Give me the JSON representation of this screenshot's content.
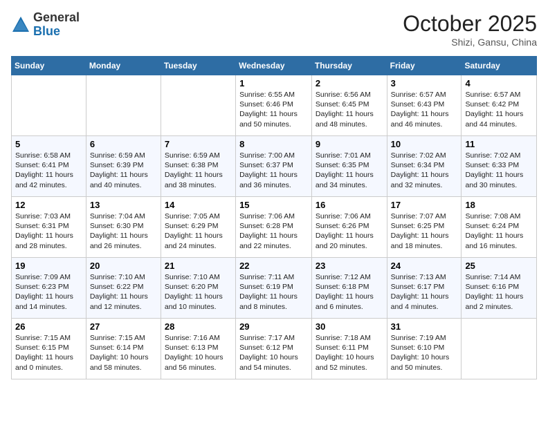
{
  "header": {
    "logo_general": "General",
    "logo_blue": "Blue",
    "month": "October 2025",
    "location": "Shizi, Gansu, China"
  },
  "days_of_week": [
    "Sunday",
    "Monday",
    "Tuesday",
    "Wednesday",
    "Thursday",
    "Friday",
    "Saturday"
  ],
  "weeks": [
    [
      {
        "day": "",
        "content": ""
      },
      {
        "day": "",
        "content": ""
      },
      {
        "day": "",
        "content": ""
      },
      {
        "day": "1",
        "content": "Sunrise: 6:55 AM\nSunset: 6:46 PM\nDaylight: 11 hours and 50 minutes."
      },
      {
        "day": "2",
        "content": "Sunrise: 6:56 AM\nSunset: 6:45 PM\nDaylight: 11 hours and 48 minutes."
      },
      {
        "day": "3",
        "content": "Sunrise: 6:57 AM\nSunset: 6:43 PM\nDaylight: 11 hours and 46 minutes."
      },
      {
        "day": "4",
        "content": "Sunrise: 6:57 AM\nSunset: 6:42 PM\nDaylight: 11 hours and 44 minutes."
      }
    ],
    [
      {
        "day": "5",
        "content": "Sunrise: 6:58 AM\nSunset: 6:41 PM\nDaylight: 11 hours and 42 minutes."
      },
      {
        "day": "6",
        "content": "Sunrise: 6:59 AM\nSunset: 6:39 PM\nDaylight: 11 hours and 40 minutes."
      },
      {
        "day": "7",
        "content": "Sunrise: 6:59 AM\nSunset: 6:38 PM\nDaylight: 11 hours and 38 minutes."
      },
      {
        "day": "8",
        "content": "Sunrise: 7:00 AM\nSunset: 6:37 PM\nDaylight: 11 hours and 36 minutes."
      },
      {
        "day": "9",
        "content": "Sunrise: 7:01 AM\nSunset: 6:35 PM\nDaylight: 11 hours and 34 minutes."
      },
      {
        "day": "10",
        "content": "Sunrise: 7:02 AM\nSunset: 6:34 PM\nDaylight: 11 hours and 32 minutes."
      },
      {
        "day": "11",
        "content": "Sunrise: 7:02 AM\nSunset: 6:33 PM\nDaylight: 11 hours and 30 minutes."
      }
    ],
    [
      {
        "day": "12",
        "content": "Sunrise: 7:03 AM\nSunset: 6:31 PM\nDaylight: 11 hours and 28 minutes."
      },
      {
        "day": "13",
        "content": "Sunrise: 7:04 AM\nSunset: 6:30 PM\nDaylight: 11 hours and 26 minutes."
      },
      {
        "day": "14",
        "content": "Sunrise: 7:05 AM\nSunset: 6:29 PM\nDaylight: 11 hours and 24 minutes."
      },
      {
        "day": "15",
        "content": "Sunrise: 7:06 AM\nSunset: 6:28 PM\nDaylight: 11 hours and 22 minutes."
      },
      {
        "day": "16",
        "content": "Sunrise: 7:06 AM\nSunset: 6:26 PM\nDaylight: 11 hours and 20 minutes."
      },
      {
        "day": "17",
        "content": "Sunrise: 7:07 AM\nSunset: 6:25 PM\nDaylight: 11 hours and 18 minutes."
      },
      {
        "day": "18",
        "content": "Sunrise: 7:08 AM\nSunset: 6:24 PM\nDaylight: 11 hours and 16 minutes."
      }
    ],
    [
      {
        "day": "19",
        "content": "Sunrise: 7:09 AM\nSunset: 6:23 PM\nDaylight: 11 hours and 14 minutes."
      },
      {
        "day": "20",
        "content": "Sunrise: 7:10 AM\nSunset: 6:22 PM\nDaylight: 11 hours and 12 minutes."
      },
      {
        "day": "21",
        "content": "Sunrise: 7:10 AM\nSunset: 6:20 PM\nDaylight: 11 hours and 10 minutes."
      },
      {
        "day": "22",
        "content": "Sunrise: 7:11 AM\nSunset: 6:19 PM\nDaylight: 11 hours and 8 minutes."
      },
      {
        "day": "23",
        "content": "Sunrise: 7:12 AM\nSunset: 6:18 PM\nDaylight: 11 hours and 6 minutes."
      },
      {
        "day": "24",
        "content": "Sunrise: 7:13 AM\nSunset: 6:17 PM\nDaylight: 11 hours and 4 minutes."
      },
      {
        "day": "25",
        "content": "Sunrise: 7:14 AM\nSunset: 6:16 PM\nDaylight: 11 hours and 2 minutes."
      }
    ],
    [
      {
        "day": "26",
        "content": "Sunrise: 7:15 AM\nSunset: 6:15 PM\nDaylight: 11 hours and 0 minutes."
      },
      {
        "day": "27",
        "content": "Sunrise: 7:15 AM\nSunset: 6:14 PM\nDaylight: 10 hours and 58 minutes."
      },
      {
        "day": "28",
        "content": "Sunrise: 7:16 AM\nSunset: 6:13 PM\nDaylight: 10 hours and 56 minutes."
      },
      {
        "day": "29",
        "content": "Sunrise: 7:17 AM\nSunset: 6:12 PM\nDaylight: 10 hours and 54 minutes."
      },
      {
        "day": "30",
        "content": "Sunrise: 7:18 AM\nSunset: 6:11 PM\nDaylight: 10 hours and 52 minutes."
      },
      {
        "day": "31",
        "content": "Sunrise: 7:19 AM\nSunset: 6:10 PM\nDaylight: 10 hours and 50 minutes."
      },
      {
        "day": "",
        "content": ""
      }
    ]
  ]
}
